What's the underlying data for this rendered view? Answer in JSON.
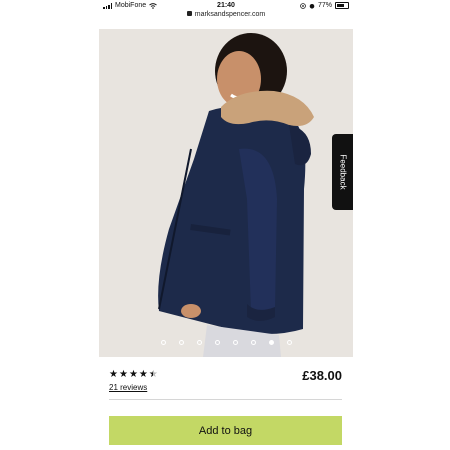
{
  "status_bar": {
    "carrier": "MobiFone",
    "time": "21:40",
    "battery": "77%",
    "signal_bars": 4
  },
  "browser": {
    "url": "marksandspencer.com"
  },
  "gallery": {
    "image_count": 8,
    "active_index": 6,
    "feedback_label": "Feedback"
  },
  "product": {
    "rating_value": 4.5,
    "reviews_label": "21 reviews",
    "price": "£38.00"
  },
  "actions": {
    "add_to_bag_label": "Add to bag"
  },
  "colors": {
    "add_to_bag_bg": "#c3d865",
    "photo_background": "#e8e4df",
    "jacket_navy": "#1d2a4a",
    "fur_trim": "#c9a27a"
  }
}
